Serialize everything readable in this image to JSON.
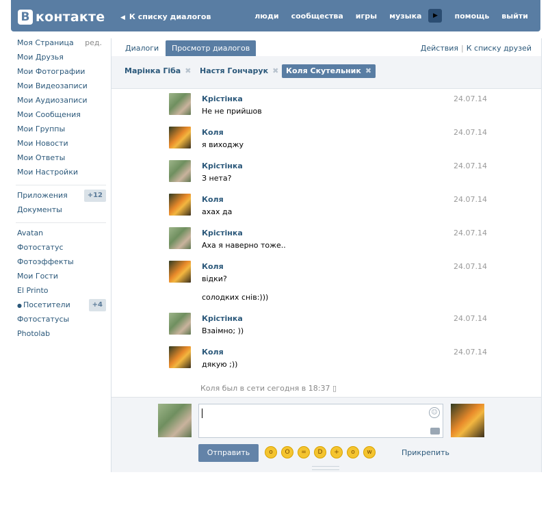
{
  "header": {
    "logo_letter": "В",
    "logo_text": "контакте",
    "back_link": "К списку диалогов",
    "nav": [
      "люди",
      "сообщества",
      "игры",
      "музыка",
      "помощь",
      "выйти"
    ]
  },
  "sidebar": {
    "my_page": "Моя Страница",
    "edit": "ред.",
    "items": [
      "Мои Друзья",
      "Мои Фотографии",
      "Мои Видеозаписи",
      "Мои Аудиозаписи",
      "Мои Сообщения",
      "Мои Группы",
      "Мои Новости",
      "Мои Ответы",
      "Мои Настройки"
    ],
    "apps": "Приложения",
    "apps_badge": "+12",
    "docs": "Документы",
    "apps_list": [
      "Avatan",
      "Фотостатус",
      "Фотоэффекты",
      "Мои Гости",
      "El Printo"
    ],
    "visitors": "Посетители",
    "visitors_badge": "+4",
    "more_apps": [
      "Фотостатусы",
      "Photolab"
    ]
  },
  "tabs": {
    "dialogs": "Диалоги",
    "view": "Просмотр диалогов",
    "actions": "Действия",
    "to_friends": "К списку друзей"
  },
  "peers": [
    "Марінка Гіба",
    "Настя Гончарук",
    "Коля Скутельник"
  ],
  "messages": [
    {
      "author": "Крістінка",
      "date": "24.07.14",
      "text": "Не не прийшов"
    },
    {
      "author": "Коля",
      "date": "24.07.14",
      "text": "я виходжу"
    },
    {
      "author": "Крістінка",
      "date": "24.07.14",
      "text": "З нета?"
    },
    {
      "author": "Коля",
      "date": "24.07.14",
      "text": "ахах да"
    },
    {
      "author": "Крістінка",
      "date": "24.07.14",
      "text": "Аха я наверно тоже.."
    },
    {
      "author": "Коля",
      "date": "24.07.14",
      "text": "відки?",
      "text2": "солодких снів:)))"
    },
    {
      "author": "Крістінка",
      "date": "24.07.14",
      "text": "Взаімно; ))"
    },
    {
      "author": "Коля",
      "date": "24.07.14",
      "text": "дякую ;))"
    }
  ],
  "status": "Коля был в сети сегодня в 18:37",
  "composer": {
    "send": "Отправить",
    "attach": "Прикрепить"
  }
}
